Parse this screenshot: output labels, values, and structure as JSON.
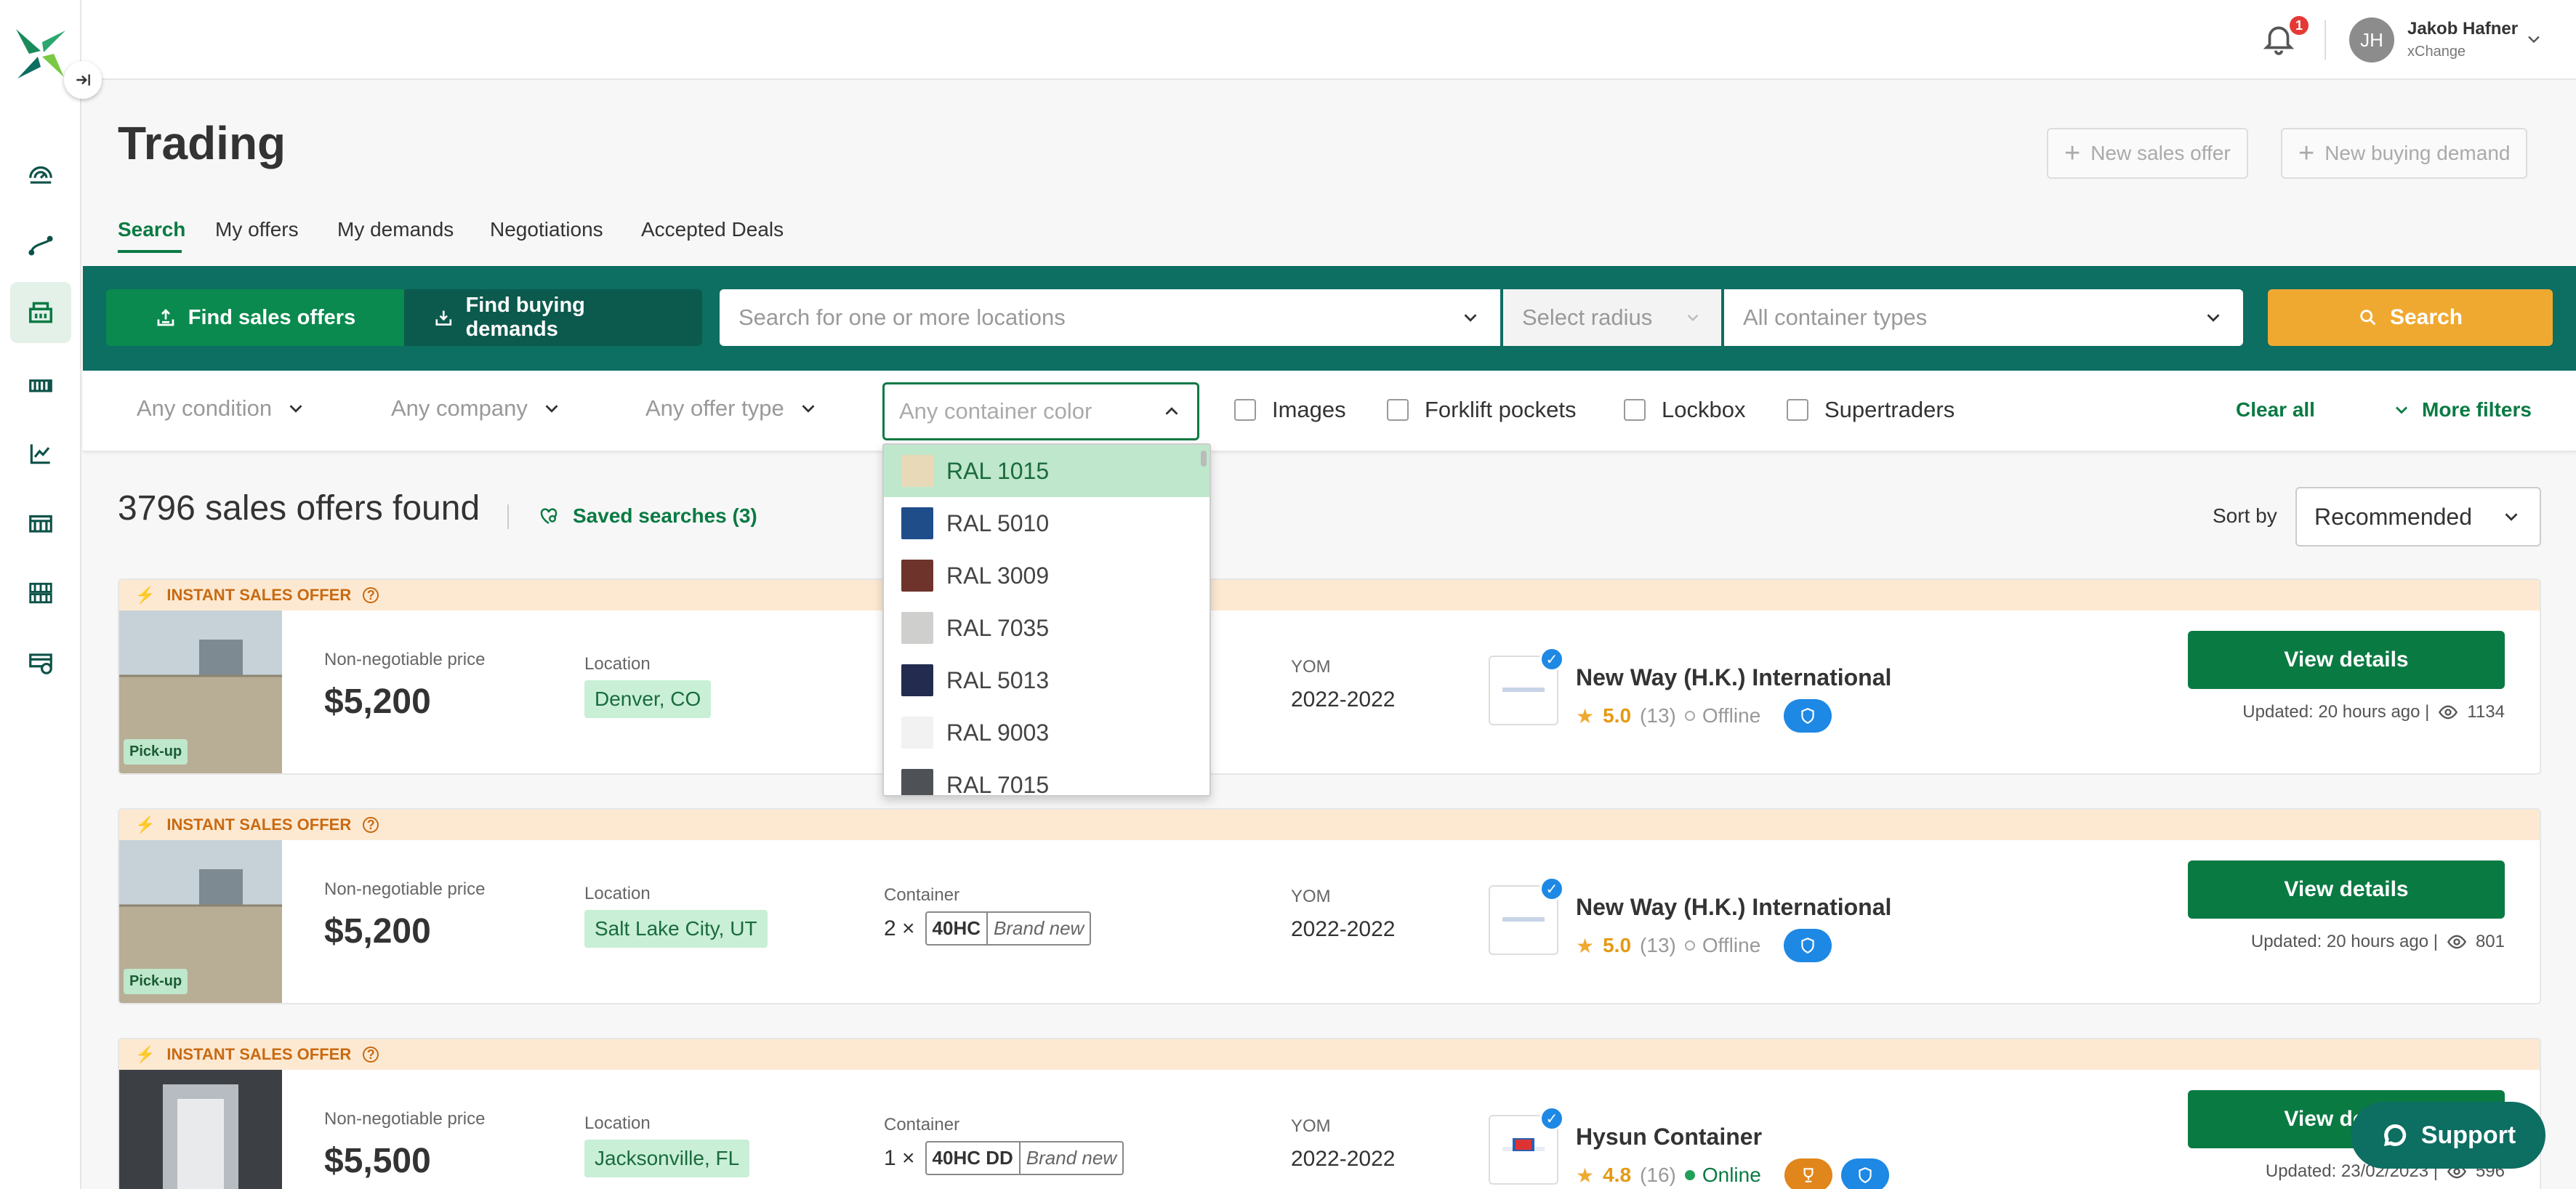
{
  "app": {
    "user_name": "Jakob Hafner",
    "user_company": "xChange",
    "user_initials": "JH",
    "notification_count": "1"
  },
  "page": {
    "title": "Trading",
    "new_sales_offer": "New sales offer",
    "new_buying_demand": "New buying demand"
  },
  "tabs": [
    "Search",
    "My offers",
    "My demands",
    "Negotiations",
    "Accepted Deals"
  ],
  "search": {
    "mode_sales": "Find sales offers",
    "mode_buying": "Find buying demands",
    "location_placeholder": "Search for one or more locations",
    "radius_placeholder": "Select radius",
    "container_types_placeholder": "All container types",
    "search_button": "Search"
  },
  "filters": {
    "condition": "Any condition",
    "company": "Any company",
    "offer_type": "Any offer type",
    "container_color": "Any container color",
    "images": "Images",
    "forklift": "Forklift pockets",
    "lockbox": "Lockbox",
    "supertraders": "Supertraders",
    "clear_all": "Clear all",
    "more_filters": "More filters"
  },
  "color_options": [
    {
      "label": "RAL 1015",
      "color": "#e8d9b8"
    },
    {
      "label": "RAL 5010",
      "color": "#1f4d8a"
    },
    {
      "label": "RAL 3009",
      "color": "#6e342b"
    },
    {
      "label": "RAL 7035",
      "color": "#cfd0ce"
    },
    {
      "label": "RAL 5013",
      "color": "#232c4f"
    },
    {
      "label": "RAL 9003",
      "color": "#f2f2f2"
    },
    {
      "label": "RAL 7015",
      "color": "#4e5257"
    }
  ],
  "results": {
    "count_text": "3796 sales offers found",
    "saved_searches": "Saved searches (3)",
    "sort_label": "Sort by",
    "sort_value": "Recommended"
  },
  "labels": {
    "instant": "INSTANT SALES OFFER",
    "price": "Non-negotiable price",
    "location": "Location",
    "container": "Container",
    "yom": "YOM",
    "view_details": "View details",
    "pickup": "Pick-up"
  },
  "offers": [
    {
      "price": "$5,200",
      "location": "Denver, CO",
      "qty": "",
      "size": "",
      "condition": "",
      "yom": "2022-2022",
      "company": "New Way (H.K.) International",
      "rating": "5.0",
      "reviews": "(13)",
      "status": "Offline",
      "updated": "Updated: 20 hours ago |",
      "views": "1134"
    },
    {
      "price": "$5,200",
      "location": "Salt Lake City, UT",
      "qty": "2 ×",
      "size": "40HC",
      "condition": "Brand new",
      "yom": "2022-2022",
      "company": "New Way (H.K.) International",
      "rating": "5.0",
      "reviews": "(13)",
      "status": "Offline",
      "updated": "Updated: 20 hours ago |",
      "views": "801"
    },
    {
      "price": "$5,500",
      "location": "Jacksonville, FL",
      "qty": "1 ×",
      "size": "40HC DD",
      "condition": "Brand new",
      "yom": "2022-2022",
      "company": "Hysun Container",
      "rating": "4.8",
      "reviews": "(16)",
      "status": "Online",
      "updated": "Updated: 23/02/2023 |",
      "views": "596"
    }
  ],
  "support": "Support"
}
